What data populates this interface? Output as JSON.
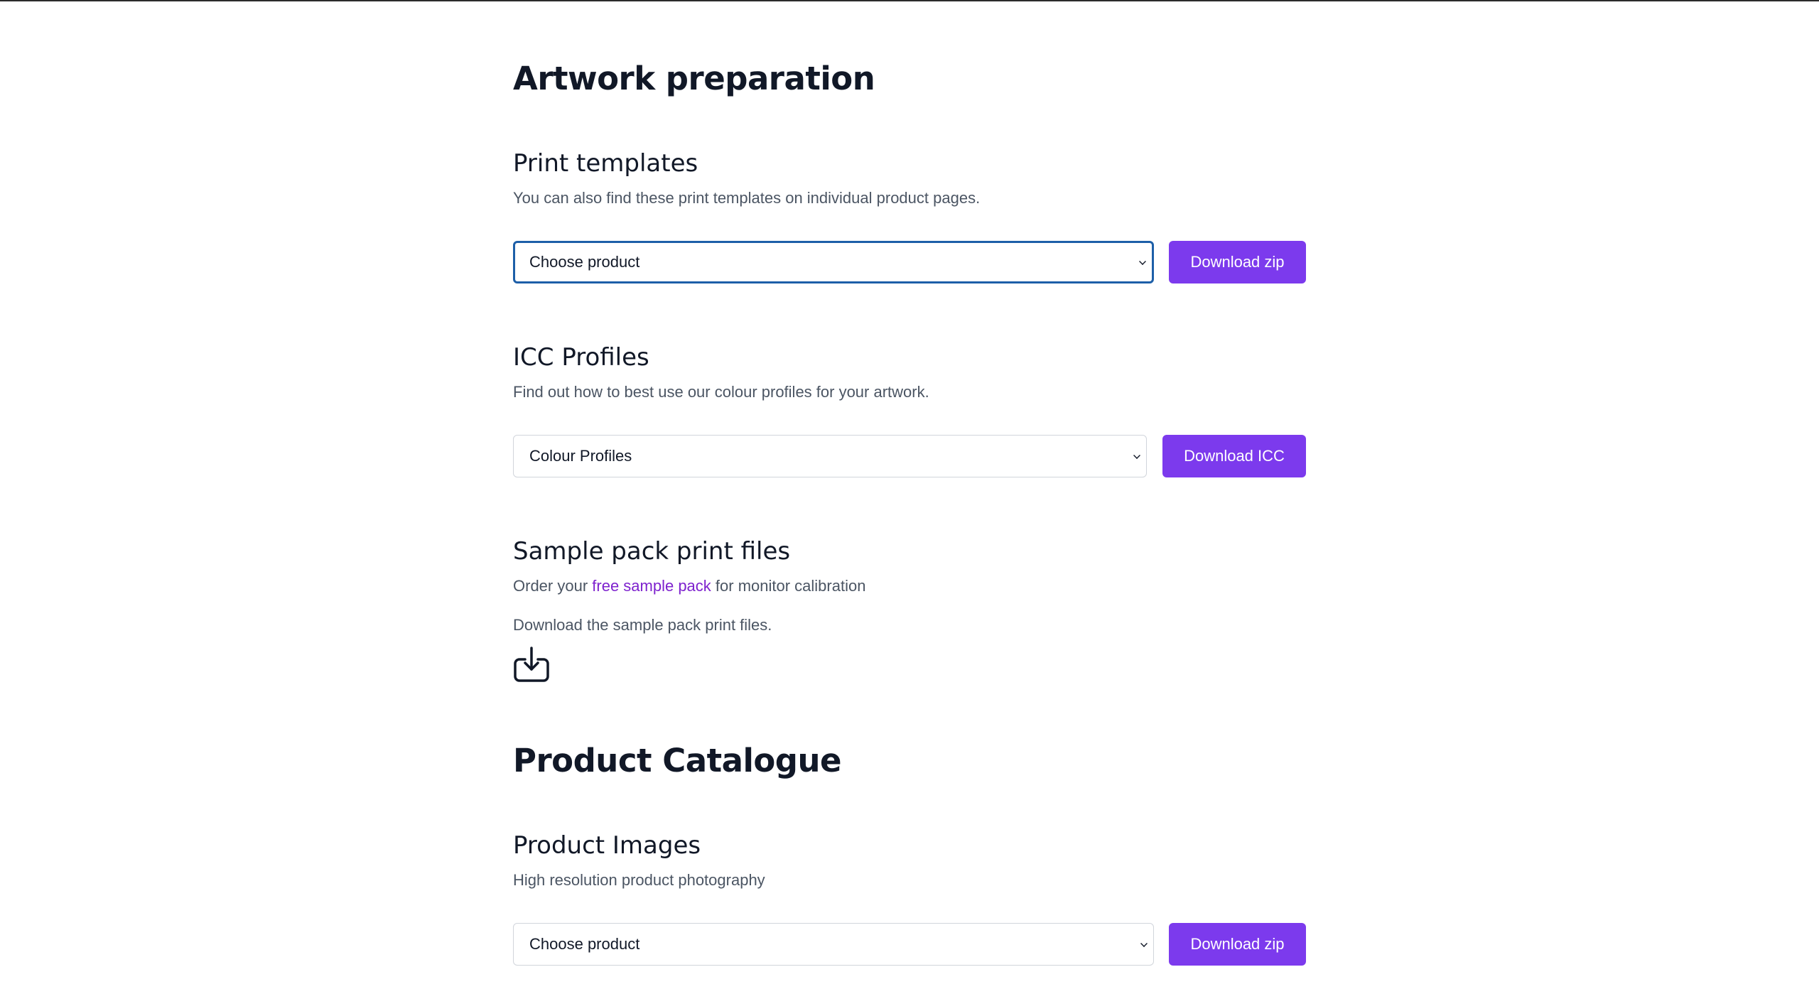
{
  "artwork": {
    "heading": "Artwork preparation",
    "print_templates": {
      "title": "Print templates",
      "description": "You can also find these print templates on individual product pages.",
      "select_value": "Choose product",
      "button_label": "Download zip"
    },
    "icc_profiles": {
      "title": "ICC Profiles",
      "description": "Find out how to best use our colour profiles for your artwork.",
      "select_value": "Colour Profiles",
      "button_label": "Download ICC"
    },
    "sample_pack": {
      "title": "Sample pack print files",
      "order_prefix": "Order your ",
      "order_link": "free sample pack",
      "order_suffix": " for monitor calibration",
      "download_text": "Download the sample pack print files.",
      "download_icon": "download-tray-icon"
    }
  },
  "catalogue": {
    "heading": "Product Catalogue",
    "product_images": {
      "title": "Product Images",
      "description": "High resolution product photography",
      "select_value": "Choose product",
      "button_label": "Download zip"
    }
  },
  "colors": {
    "accent": "#7c3aed",
    "link": "#7e22ce",
    "focus_ring": "#1d5fa8",
    "heading": "#111827",
    "muted_text": "#4b5563"
  }
}
